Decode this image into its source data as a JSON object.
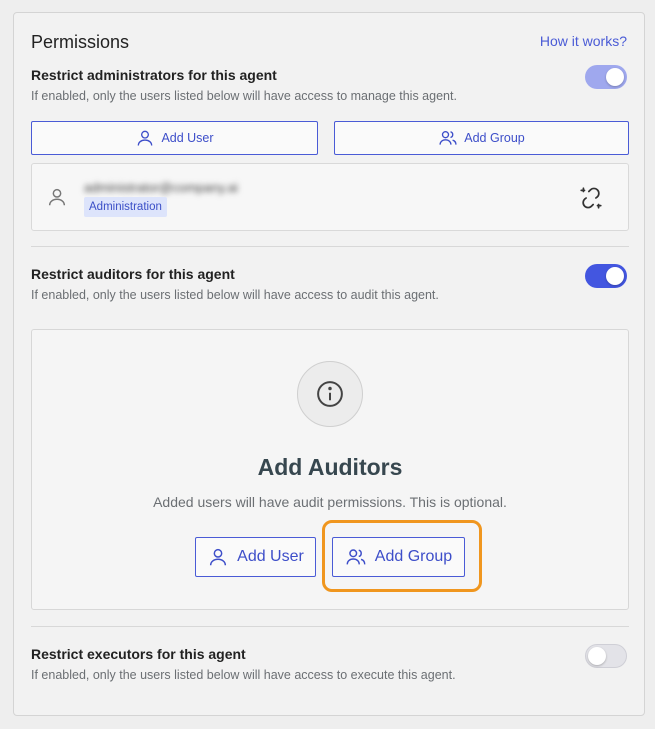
{
  "permissions": {
    "title": "Permissions",
    "help_link": "How it works?"
  },
  "administrators": {
    "title": "Restrict administrators for this agent",
    "description": "If enabled, only the users listed below will have access to manage this agent.",
    "toggle_state": "on (dimmed)",
    "add_user_label": "Add User",
    "add_group_label": "Add Group",
    "user": {
      "email": "administrator@company.ai",
      "role_badge": "Administration"
    }
  },
  "auditors": {
    "title": "Restrict auditors for this agent",
    "description": "If enabled, only the users listed below will have access to audit this agent.",
    "toggle_state": "on",
    "empty_title": "Add Auditors",
    "empty_description": "Added users will have audit permissions. This is optional.",
    "add_user_label": "Add User",
    "add_group_label": "Add Group"
  },
  "executors": {
    "title": "Restrict executors for this agent",
    "description": "If enabled, only the users listed below will have access to execute this agent.",
    "toggle_state": "off"
  },
  "colors": {
    "accent": "#4356e0",
    "highlight": "#f0961e",
    "badge_bg": "#dde4fb"
  },
  "icons": [
    "user-icon",
    "group-icon",
    "unlink-icon",
    "info-icon"
  ]
}
